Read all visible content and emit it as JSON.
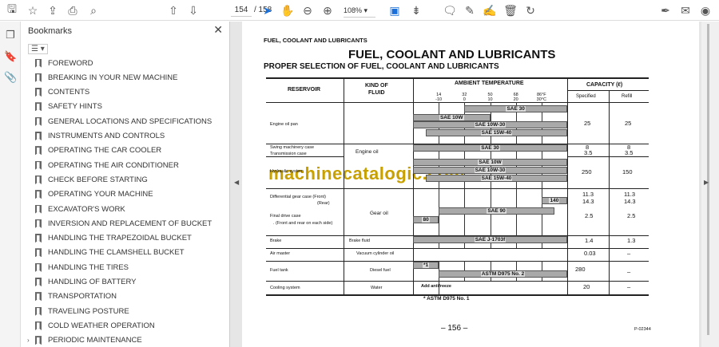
{
  "toolbar": {
    "page_current": "154",
    "page_total": "/ 158",
    "zoom": "108%"
  },
  "bookmarks": {
    "title": "Bookmarks",
    "items": [
      "FOREWORD",
      "BREAKING IN YOUR NEW MACHINE",
      "CONTENTS",
      "SAFETY HINTS",
      "GENERAL LOCATIONS AND SPECIFICATIONS",
      "INSTRUMENTS AND CONTROLS",
      "OPERATING THE CAR COOLER",
      "OPERATING THE AIR CONDITIONER",
      "CHECK BEFORE STARTING",
      "OPERATING YOUR MACHINE",
      "EXCAVATOR'S WORK",
      "INVERSION AND REPLACEMENT OF BUCKET",
      "HANDLING THE TRAPEZOIDAL BUCKET",
      "HANDLING THE CLAMSHELL BUCKET",
      "HANDLING THE TIRES",
      "HANDLING OF BATTERY",
      "TRANSPORTATION",
      "TRAVELING POSTURE",
      "COLD WEATHER OPERATION",
      "PERIODIC MAINTENANCE"
    ]
  },
  "doc": {
    "running_head": "FUEL, COOLANT AND LUBRICANTS",
    "title": "FUEL, COOLANT AND LUBRICANTS",
    "subtitle": "PROPER SELECTION OF FUEL, COOLANT AND LUBRICANTS",
    "headers": {
      "reservoir": "RESERVOIR",
      "fluid1": "KIND OF",
      "fluid2": "FLUID",
      "temp": "AMBIENT TEMPERATURE",
      "capacity": "CAPACITY (ℓ)",
      "specified": "Specified",
      "refill": "Refill"
    },
    "temp_ticks": [
      {
        "f": "14",
        "c": "-10"
      },
      {
        "f": "32",
        "c": "0"
      },
      {
        "f": "50",
        "c": "10"
      },
      {
        "f": "68",
        "c": "20"
      },
      {
        "f": "86°F",
        "c": "30°C"
      }
    ],
    "rows": [
      {
        "reservoir": "Engine oil pan",
        "spec": "25",
        "refill": "25"
      },
      {
        "reservoir": "Swing machinery case",
        "reservoir2": "Transmission case",
        "spec": "8",
        "spec2": "3.5",
        "refill": "8",
        "refill2": "3.5"
      },
      {
        "reservoir": "Hydraulic system",
        "spec": "250",
        "refill": "150"
      },
      {
        "reservoir": "Differential gear case  (Front)",
        "reservoir2": "(Rear)",
        "spec": "11.3",
        "spec2": "14.3",
        "refill": "11.3",
        "refill2": "14.3"
      },
      {
        "reservoir": "Final drive case",
        "reservoir2": ". (Front and rear on each side)",
        "spec": "2.5",
        "refill": "2.5"
      },
      {
        "reservoir": "Brake",
        "fluid": "Brake fluid",
        "spec": "1.4",
        "refill": "1.3"
      },
      {
        "reservoir": "Air master",
        "fluid": "Vacuum cylinder oil",
        "spec": "0.03",
        "refill": "–"
      },
      {
        "reservoir": "Fuel tank",
        "fluid": "Diesel fuel",
        "spec": "280",
        "refill": "–"
      },
      {
        "reservoir": "Cooling system",
        "fluid": "Water",
        "spec": "20",
        "refill": "–",
        "note": "Add antifreeze"
      }
    ],
    "fluid_engine": "Engine oil",
    "fluid_gear": "Gear oil",
    "bars": [
      {
        "label": "SAE 30",
        "from": 0,
        "to": 40,
        "row": 0
      },
      {
        "label": "SAE 10W",
        "from": -20,
        "to": 10,
        "row": 1
      },
      {
        "label": "SAE 10W-30",
        "from": -20,
        "to": 40,
        "row": 2
      },
      {
        "label": "SAE 15W-40",
        "from": -15,
        "to": 40,
        "row": 3
      },
      {
        "label": "SAE 30",
        "from": -20,
        "to": 40,
        "row": 4
      },
      {
        "label": "SAE 10W",
        "from": -20,
        "to": 40,
        "row": 5
      },
      {
        "label": "SAE 10W-30",
        "from": -20,
        "to": 40,
        "row": 6
      },
      {
        "label": "SAE 15W-40",
        "from": -15,
        "to": 40,
        "row": 7
      },
      {
        "label": "140",
        "from": 30,
        "to": 40,
        "row": 8
      },
      {
        "label": "SAE 90",
        "from": -10,
        "to": 35,
        "row": 9
      },
      {
        "label": "80",
        "from": -20,
        "to": -10,
        "row": 10
      },
      {
        "label": "SAE J-1703f",
        "from": -20,
        "to": 40,
        "row": 11
      },
      {
        "label": "*1",
        "from": -20,
        "to": -10,
        "row": 12
      },
      {
        "label": "ASTM D975 No. 2",
        "from": -10,
        "to": 40,
        "row": 13
      }
    ],
    "footnote": "*  ASTM D975 No. 1",
    "page_number": "– 156 –",
    "code": "P-02344",
    "watermark": "machinecatalogic.com"
  }
}
